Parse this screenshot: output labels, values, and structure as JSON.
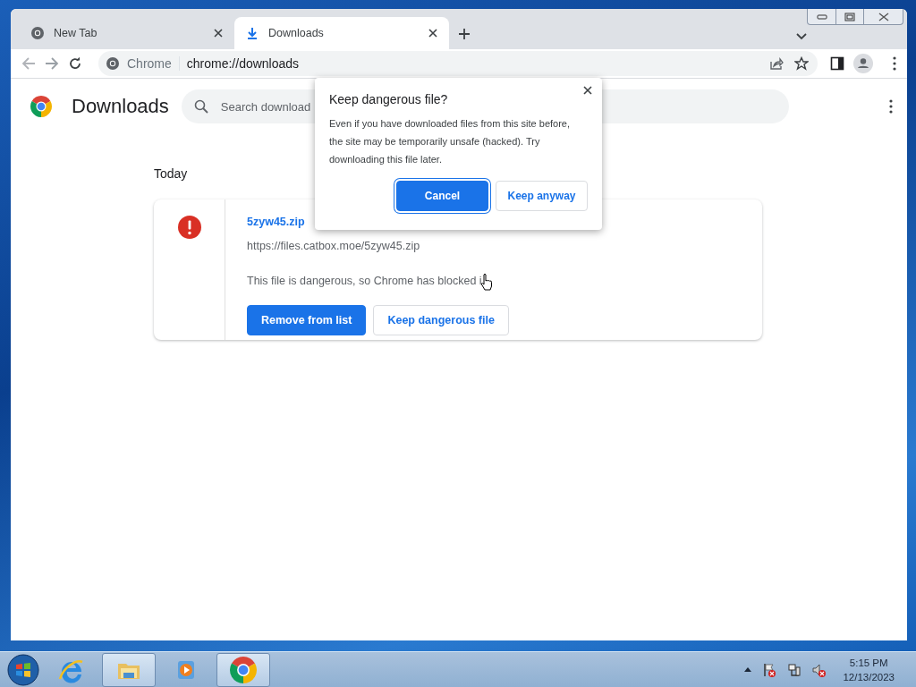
{
  "tabs": [
    {
      "title": "New Tab",
      "kind": "chrome",
      "selected": false
    },
    {
      "title": "Downloads",
      "kind": "download",
      "selected": true
    }
  ],
  "omnibox": {
    "chip": "Chrome",
    "url": "chrome://downloads"
  },
  "page": {
    "title": "Downloads",
    "search": {
      "placeholder": "Search download"
    },
    "section": "Today",
    "item": {
      "filename": "5zyw45.zip",
      "url": "https://files.catbox.moe/5zyw45.zip",
      "message": "This file is dangerous, so Chrome has blocked i",
      "buttons": [
        {
          "label": "Remove from list",
          "kind": "primary"
        },
        {
          "label": "Keep dangerous file",
          "kind": "secondary"
        }
      ]
    }
  },
  "dialog": {
    "title": "Keep dangerous file?",
    "body": "Even if you have downloaded files from this site before, the site may be temporarily unsafe (hacked). Try downloading this file later.",
    "buttons": [
      {
        "label": "Cancel",
        "kind": "primary",
        "focused": true
      },
      {
        "label": "Keep anyway",
        "kind": "secondary",
        "focused": false
      }
    ]
  },
  "taskbar": {
    "apps": [
      {
        "kind": "ie",
        "running": false
      },
      {
        "kind": "explorer",
        "running": true
      },
      {
        "kind": "media",
        "running": false
      },
      {
        "kind": "chrome",
        "running": true
      }
    ],
    "time": "5:15 PM",
    "date": "12/13/2023"
  }
}
